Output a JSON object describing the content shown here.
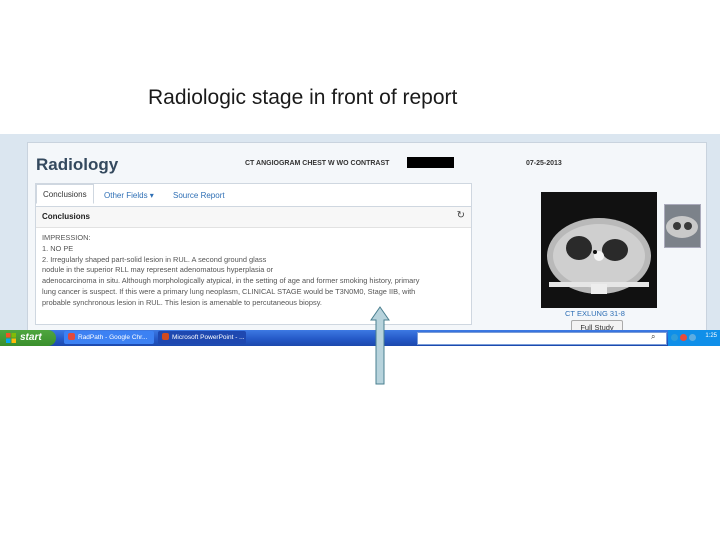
{
  "slide": {
    "title": "Radiologic stage in front of report"
  },
  "app": {
    "title": "Radiology",
    "study_name": "CT ANGIOGRAM CHEST W WO CONTRAST",
    "study_date": "07-25-2013"
  },
  "tabs": [
    {
      "label": "Conclusions",
      "active": true
    },
    {
      "label": "Other Fields ▾",
      "active": false
    },
    {
      "label": "Source Report",
      "active": false
    }
  ],
  "section": {
    "label": "Conclusions",
    "refresh_icon": "refresh-icon"
  },
  "report_lines": [
    "IMPRESSION:",
    "1. NO PE",
    "2. Irregularly shaped part-solid lesion in RUL. A second ground glass",
    "nodule in the superior RLL may represent adenomatous hyperplasia or",
    "adenocarcinoma in situ. Although morphologically atypical, in the setting of age and former smoking history, primary",
    "lung cancer is suspect. If this were a primary lung neoplasm, CLINICAL STAGE would be T3N0M0, Stage IIB, with",
    "probable synchronous lesion in RUL. This lesion is amenable to percutaneous biopsy."
  ],
  "image_panel": {
    "caption": "CT EXLUNG 31-8",
    "full_study_label": "Full Study"
  },
  "taskbar": {
    "start_label": "start",
    "items": [
      {
        "label": "RadPath - Google Chr...",
        "icon": "chrome-icon",
        "color": "#e0493d"
      },
      {
        "label": "Microsoft PowerPoint - ...",
        "icon": "powerpoint-icon",
        "color": "#d04a1f"
      }
    ],
    "clock": "1:25"
  },
  "colors": {
    "accent": "#2e6fb5",
    "taskbar": "#2357c5",
    "start": "#3a8f2c"
  }
}
